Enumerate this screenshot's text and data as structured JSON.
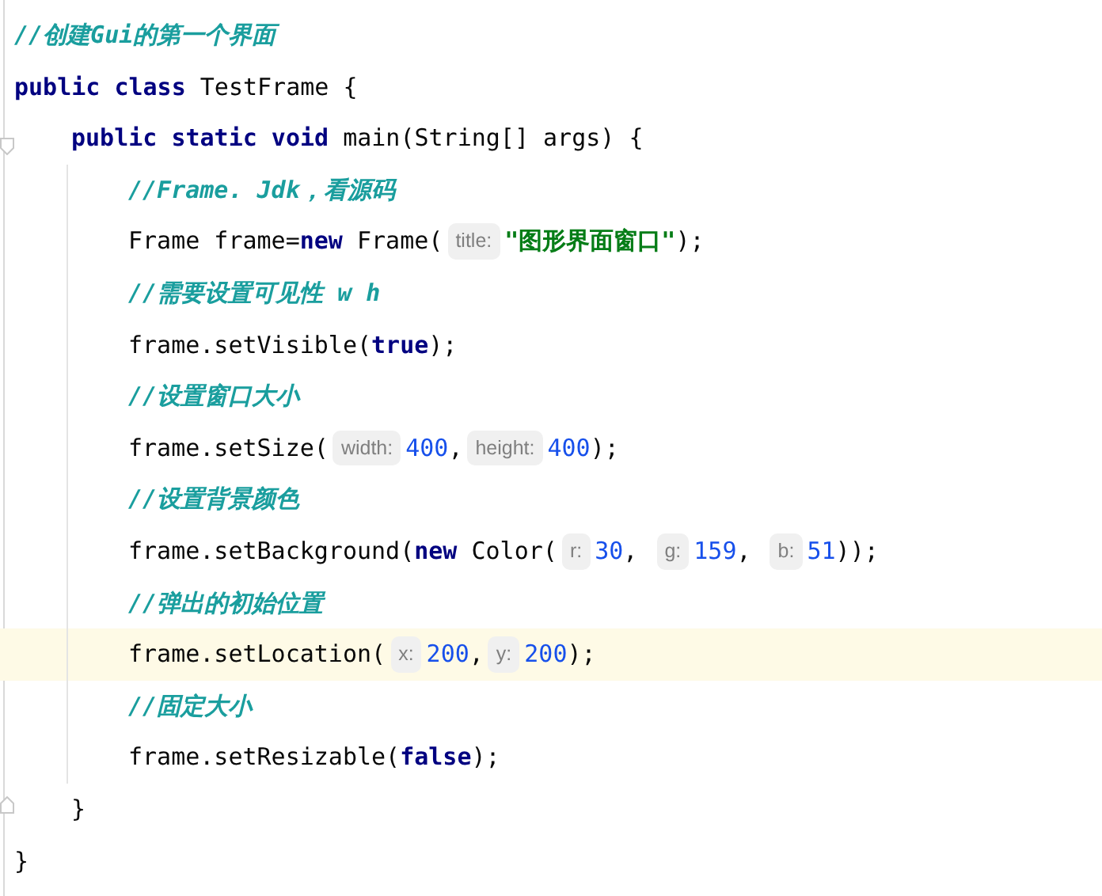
{
  "code_lines": [
    {
      "kind": "code",
      "highlighted": false,
      "tokens": [
        {
          "kind": "comment",
          "text": "//创建Gui的第一个界面"
        }
      ]
    },
    {
      "kind": "code",
      "highlighted": false,
      "tokens": [
        {
          "kind": "keyword",
          "text": "public class"
        },
        {
          "kind": "plain",
          "text": " TestFrame {"
        }
      ],
      "children": [
        {
          "kind": "fold-start",
          "highlighted": false,
          "tokens": [
            {
              "kind": "keyword",
              "text": "public static void"
            },
            {
              "kind": "plain",
              "text": " main(String[] args) {"
            }
          ],
          "children": [
            {
              "kind": "code",
              "highlighted": false,
              "tokens": [
                {
                  "kind": "comment",
                  "text": "//Frame. Jdk，看源码"
                }
              ]
            },
            {
              "kind": "code",
              "highlighted": false,
              "tokens": [
                {
                  "kind": "plain",
                  "text": "Frame frame="
                },
                {
                  "kind": "keyword",
                  "text": "new"
                },
                {
                  "kind": "plain",
                  "text": " Frame("
                },
                {
                  "kind": "hint",
                  "text": "title:"
                },
                {
                  "kind": "string",
                  "text": "\"图形界面窗口\""
                },
                {
                  "kind": "plain",
                  "text": ");"
                }
              ]
            },
            {
              "kind": "code",
              "highlighted": false,
              "tokens": [
                {
                  "kind": "comment",
                  "text": "//需要设置可见性 w h"
                }
              ]
            },
            {
              "kind": "code",
              "highlighted": false,
              "tokens": [
                {
                  "kind": "plain",
                  "text": "frame.setVisible("
                },
                {
                  "kind": "keyword",
                  "text": "true"
                },
                {
                  "kind": "plain",
                  "text": ");"
                }
              ]
            },
            {
              "kind": "code",
              "highlighted": false,
              "tokens": [
                {
                  "kind": "comment",
                  "text": "//设置窗口大小"
                }
              ]
            },
            {
              "kind": "code",
              "highlighted": false,
              "tokens": [
                {
                  "kind": "plain",
                  "text": "frame.setSize("
                },
                {
                  "kind": "hint",
                  "text": "width:"
                },
                {
                  "kind": "number",
                  "text": "400"
                },
                {
                  "kind": "plain",
                  "text": ","
                },
                {
                  "kind": "hint",
                  "text": "height:"
                },
                {
                  "kind": "number",
                  "text": "400"
                },
                {
                  "kind": "plain",
                  "text": ");"
                }
              ]
            },
            {
              "kind": "code",
              "highlighted": false,
              "tokens": [
                {
                  "kind": "comment",
                  "text": "//设置背景颜色"
                }
              ]
            },
            {
              "kind": "code",
              "highlighted": false,
              "tokens": [
                {
                  "kind": "plain",
                  "text": "frame.setBackground("
                },
                {
                  "kind": "keyword",
                  "text": "new"
                },
                {
                  "kind": "plain",
                  "text": " Color("
                },
                {
                  "kind": "hint",
                  "text": "r:"
                },
                {
                  "kind": "number",
                  "text": "30"
                },
                {
                  "kind": "plain",
                  "text": ", "
                },
                {
                  "kind": "hint",
                  "text": "g:"
                },
                {
                  "kind": "number",
                  "text": "159"
                },
                {
                  "kind": "plain",
                  "text": ", "
                },
                {
                  "kind": "hint",
                  "text": "b:"
                },
                {
                  "kind": "number",
                  "text": "51"
                },
                {
                  "kind": "plain",
                  "text": "));"
                }
              ]
            },
            {
              "kind": "code",
              "highlighted": false,
              "tokens": [
                {
                  "kind": "comment",
                  "text": "//弹出的初始位置"
                }
              ]
            },
            {
              "kind": "code",
              "highlighted": true,
              "tokens": [
                {
                  "kind": "plain",
                  "text": "frame.setLocation("
                },
                {
                  "kind": "hint",
                  "text": "x:"
                },
                {
                  "kind": "number",
                  "text": "200"
                },
                {
                  "kind": "plain",
                  "text": ","
                },
                {
                  "kind": "hint",
                  "text": "y:"
                },
                {
                  "kind": "number",
                  "text": "200"
                },
                {
                  "kind": "plain",
                  "text": ");"
                }
              ]
            },
            {
              "kind": "code",
              "highlighted": false,
              "tokens": [
                {
                  "kind": "comment",
                  "text": "//固定大小"
                }
              ]
            },
            {
              "kind": "code",
              "highlighted": false,
              "tokens": [
                {
                  "kind": "plain",
                  "text": "frame.setResizable("
                },
                {
                  "kind": "keyword",
                  "text": "false"
                },
                {
                  "kind": "plain",
                  "text": ");"
                }
              ]
            }
          ]
        },
        {
          "kind": "fold-end",
          "highlighted": false,
          "tokens": [
            {
              "kind": "plain",
              "text": "}"
            }
          ]
        }
      ]
    },
    {
      "kind": "code",
      "highlighted": false,
      "tokens": [
        {
          "kind": "plain",
          "text": "}"
        }
      ]
    }
  ]
}
